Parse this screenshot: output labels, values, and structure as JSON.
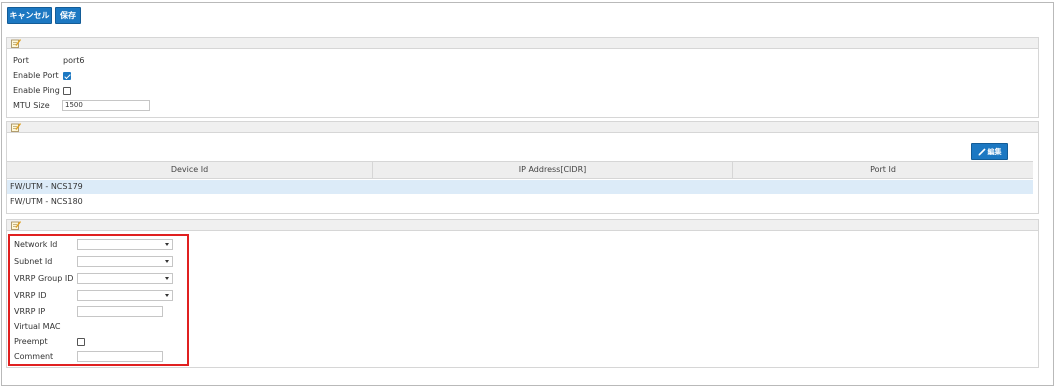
{
  "toolbar": {
    "cancel_label": "キャンセル",
    "save_label": "保存"
  },
  "port_panel": {
    "port_label": "Port",
    "port_value": "port6",
    "enable_port_label": "Enable Port",
    "enable_port_checked": true,
    "enable_ping_label": "Enable Ping",
    "enable_ping_checked": false,
    "mtu_label": "MTU Size",
    "mtu_value": "1500"
  },
  "device_panel": {
    "edit_label": "編集",
    "columns": [
      "Device Id",
      "IP Address[CIDR]",
      "Port Id"
    ],
    "rows": [
      {
        "device_id": "FW/UTM - NCS179",
        "ip_address": "",
        "port_id": "",
        "selected": true
      },
      {
        "device_id": "FW/UTM - NCS180",
        "ip_address": "",
        "port_id": "",
        "selected": false
      }
    ]
  },
  "vrrp_panel": {
    "network_id_label": "Network Id",
    "network_id_value": "",
    "subnet_id_label": "Subnet Id",
    "subnet_id_value": "",
    "vrrp_group_id_label": "VRRP Group ID",
    "vrrp_group_id_value": "",
    "vrrp_id_label": "VRRP ID",
    "vrrp_id_value": "",
    "vrrp_ip_label": "VRRP IP",
    "vrrp_ip_value": "",
    "virtual_mac_label": "Virtual MAC",
    "preempt_label": "Preempt",
    "preempt_checked": false,
    "comment_label": "Comment",
    "comment_value": ""
  },
  "colors": {
    "button_blue": "#1c78c2",
    "highlight_red": "#e02020",
    "selected_row": "#dcebf8"
  }
}
